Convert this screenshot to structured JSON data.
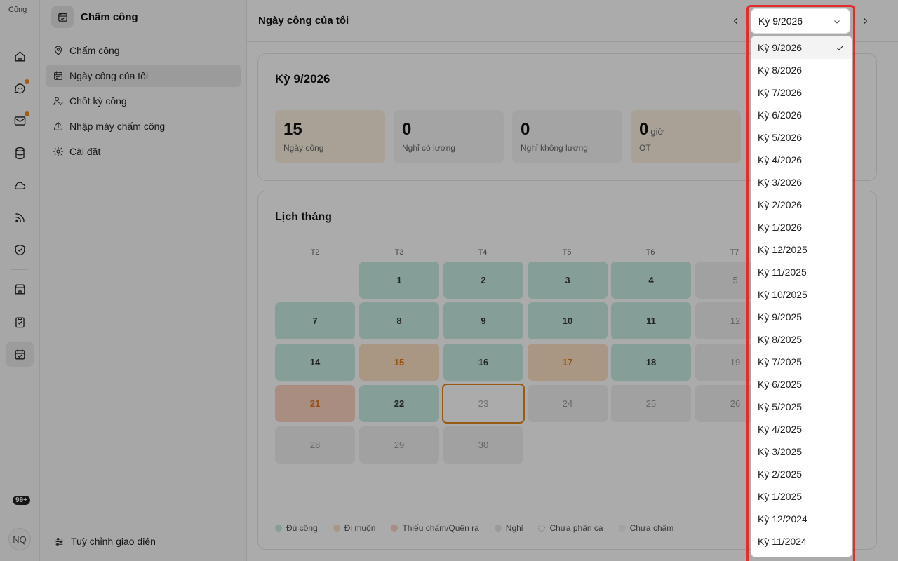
{
  "rail": {
    "logo_alt": "Công",
    "badge": "99+",
    "avatar": "NQ",
    "icons": [
      "home-icon",
      "chat-icon",
      "mail-icon",
      "database-icon",
      "cloud-icon",
      "rss-icon",
      "shield-icon",
      "store-icon",
      "clipboard-icon",
      "calendar-check-icon"
    ]
  },
  "sidebar": {
    "title": "Chấm công",
    "items": [
      {
        "label": "Chấm công",
        "icon": "location-icon"
      },
      {
        "label": "Ngày công của tôi",
        "icon": "calendar-icon"
      },
      {
        "label": "Chốt kỳ công",
        "icon": "user-check-icon"
      },
      {
        "label": "Nhập máy chấm công",
        "icon": "upload-icon"
      },
      {
        "label": "Cài đặt",
        "icon": "gear-icon"
      }
    ],
    "footer": "Tuỳ chỉnh giao diện"
  },
  "header": {
    "title": "Ngày công của tôi"
  },
  "period": {
    "title": "Kỳ 9/2026",
    "stats": [
      {
        "value": "15",
        "unit": "",
        "label": "Ngày công"
      },
      {
        "value": "0",
        "unit": "",
        "label": "Nghỉ có lương"
      },
      {
        "value": "0",
        "unit": "",
        "label": "Nghỉ không lương"
      },
      {
        "value": "0",
        "unit": "giờ",
        "label": "OT"
      }
    ]
  },
  "calendar": {
    "title": "Lịch tháng",
    "weekdays": [
      "T2",
      "T3",
      "T4",
      "T5",
      "T6",
      "T7"
    ],
    "days": [
      "1",
      "2",
      "3",
      "4",
      "5",
      "7",
      "8",
      "9",
      "10",
      "11",
      "12",
      "14",
      "15",
      "16",
      "17",
      "18",
      "19",
      "21",
      "22",
      "23",
      "24",
      "25",
      "26",
      "28",
      "29",
      "30"
    ]
  },
  "legend": [
    "Đủ công",
    "Đi muộn",
    "Thiếu chấm/Quên ra",
    "Nghỉ",
    "Chưa phân ca",
    "Chưa chấm"
  ],
  "select": {
    "value": "Kỳ 9/2026",
    "options": [
      "Kỳ 9/2026",
      "Kỳ 8/2026",
      "Kỳ 7/2026",
      "Kỳ 6/2026",
      "Kỳ 5/2026",
      "Kỳ 4/2026",
      "Kỳ 3/2026",
      "Kỳ 2/2026",
      "Kỳ 1/2026",
      "Kỳ 12/2025",
      "Kỳ 11/2025",
      "Kỳ 10/2025",
      "Kỳ 9/2025",
      "Kỳ 8/2025",
      "Kỳ 7/2025",
      "Kỳ 6/2025",
      "Kỳ 5/2025",
      "Kỳ 4/2025",
      "Kỳ 3/2025",
      "Kỳ 2/2025",
      "Kỳ 1/2025",
      "Kỳ 12/2024",
      "Kỳ 11/2024"
    ]
  },
  "colors": {
    "ok": "#c7ece3",
    "late": "#fde2c4",
    "missing": "#fcd2c1",
    "off": "#e6e6e6",
    "highlight": "#e62b2b"
  }
}
